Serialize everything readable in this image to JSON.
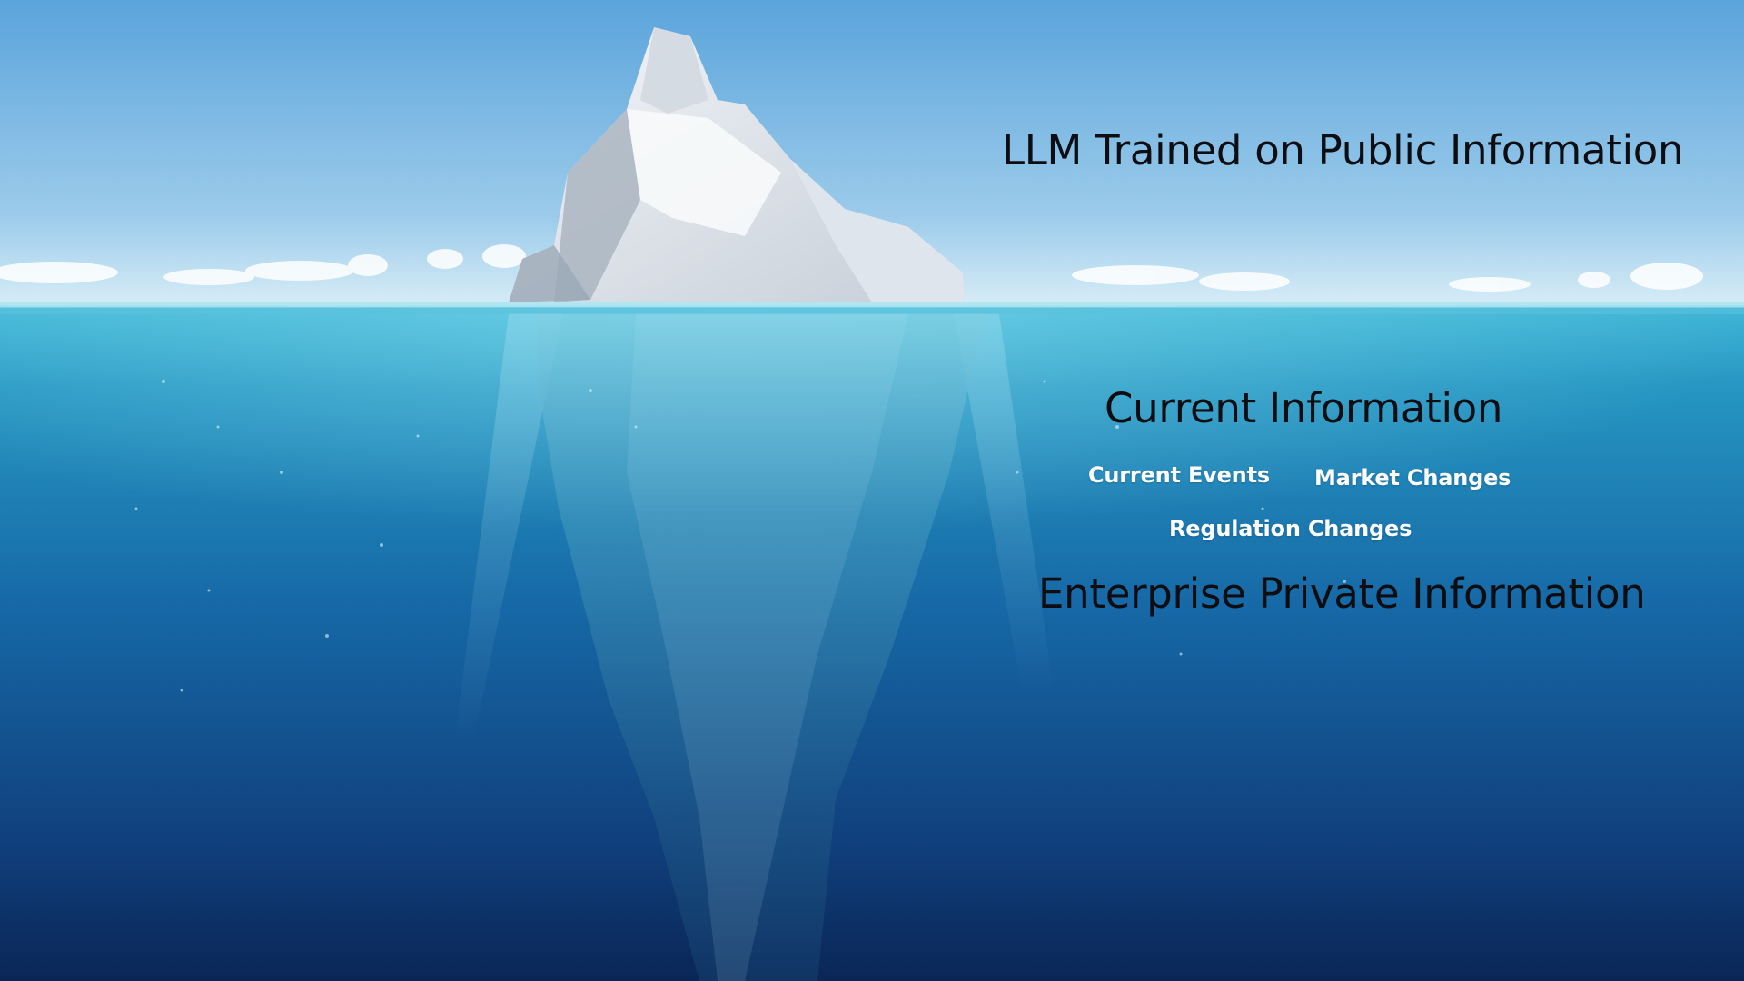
{
  "labels": {
    "public": "LLM Trained on Public Information",
    "current": "Current Information",
    "private": "Enterprise Private Information"
  },
  "tags": {
    "current_events": "Current Events",
    "market_changes": "Market Changes",
    "regulation_changes": "Regulation Changes"
  },
  "colors": {
    "sky_top": "#5ea8df",
    "sky_horizon": "#d6ecf6",
    "water_surface": "#2fa8cc",
    "water_deep": "#0b2a5a",
    "ice_light": "#f2f5f8",
    "ice_shadow": "#b4bfca",
    "heading_text": "#0d0d12",
    "tag_text": "#ffffff"
  }
}
